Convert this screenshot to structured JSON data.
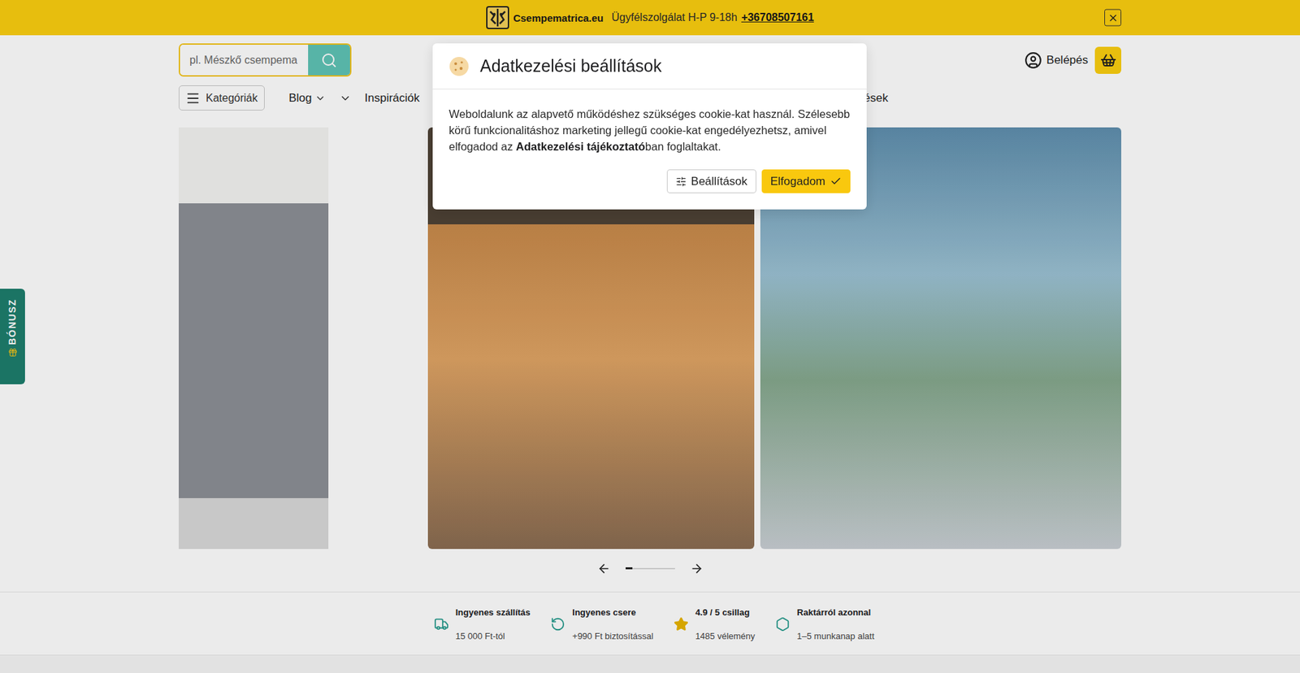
{
  "top_bar": {
    "brand": "Csempematrica.eu",
    "support": "Ügyfélszolgálat H-P 9-18h",
    "phone": "+36708507161"
  },
  "search": {
    "placeholder": "pl. Mészkő csempema"
  },
  "account": {
    "login": "Belépés"
  },
  "nav": [
    {
      "kind": "menu",
      "label": "Kategóriák"
    },
    {
      "kind": "dropdown",
      "label": "Blog"
    },
    {
      "kind": "toggle",
      "label": ""
    },
    {
      "kind": "link",
      "label": "Inspirációk"
    },
    {
      "kind": "tail",
      "label": "ések"
    }
  ],
  "carousel": {
    "level": 0.15
  },
  "features": [
    {
      "kind": "shipping",
      "title": "Ingyenes szállítás",
      "detail": "15 000 Ft-tól"
    },
    {
      "kind": "exchange",
      "title": "Ingyenes csere",
      "detail": "+990 Ft biztosítással"
    },
    {
      "kind": "rating",
      "title": "4.9 / 5 csillag",
      "detail": "1485 vélemény"
    },
    {
      "kind": "stock",
      "title": "Raktárról azonnal",
      "detail": "1–5 munkanap alatt"
    }
  ],
  "bonus_tab": {
    "label": "BÓNUSZ"
  },
  "cookie_dialog": {
    "title": "Adatkezelési beállítások",
    "text_before": "Weboldalunk az alapvető működéshez szükséges cookie-kat használ. Szélesebb körű funkcionalitáshoz marketing jellegű cookie-kat engedélyezhetsz, amivel elfogadod az ",
    "link": "Adatkezelési tájékoztató",
    "text_after": "ban foglaltakat.",
    "buttons": [
      {
        "kind": "secondary",
        "label": "Beállítások"
      },
      {
        "kind": "primary",
        "label": "Elfogadom"
      }
    ]
  }
}
